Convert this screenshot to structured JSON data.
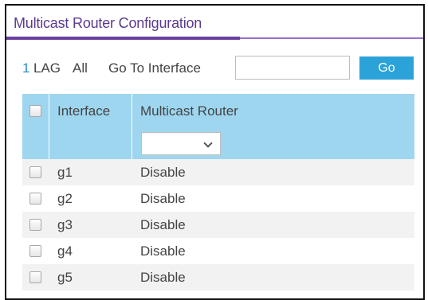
{
  "title": "Multicast Router Configuration",
  "toolbar": {
    "one": "1",
    "lag": "LAG",
    "all": "All",
    "goto_label": "Go To Interface",
    "input_value": "",
    "go_label": "Go"
  },
  "table": {
    "headers": [
      "Interface",
      "Multicast Router"
    ],
    "filter_value": "",
    "rows": [
      {
        "interface": "g1",
        "multicast_router": "Disable"
      },
      {
        "interface": "g2",
        "multicast_router": "Disable"
      },
      {
        "interface": "g3",
        "multicast_router": "Disable"
      },
      {
        "interface": "g4",
        "multicast_router": "Disable"
      },
      {
        "interface": "g5",
        "multicast_router": "Disable"
      }
    ]
  },
  "colors": {
    "title": "#5b3a8f",
    "accent_underline": "#6b3fa0",
    "header_bg": "#9ed6f0",
    "go_button": "#2ca3d8",
    "link": "#2a8fc9"
  }
}
